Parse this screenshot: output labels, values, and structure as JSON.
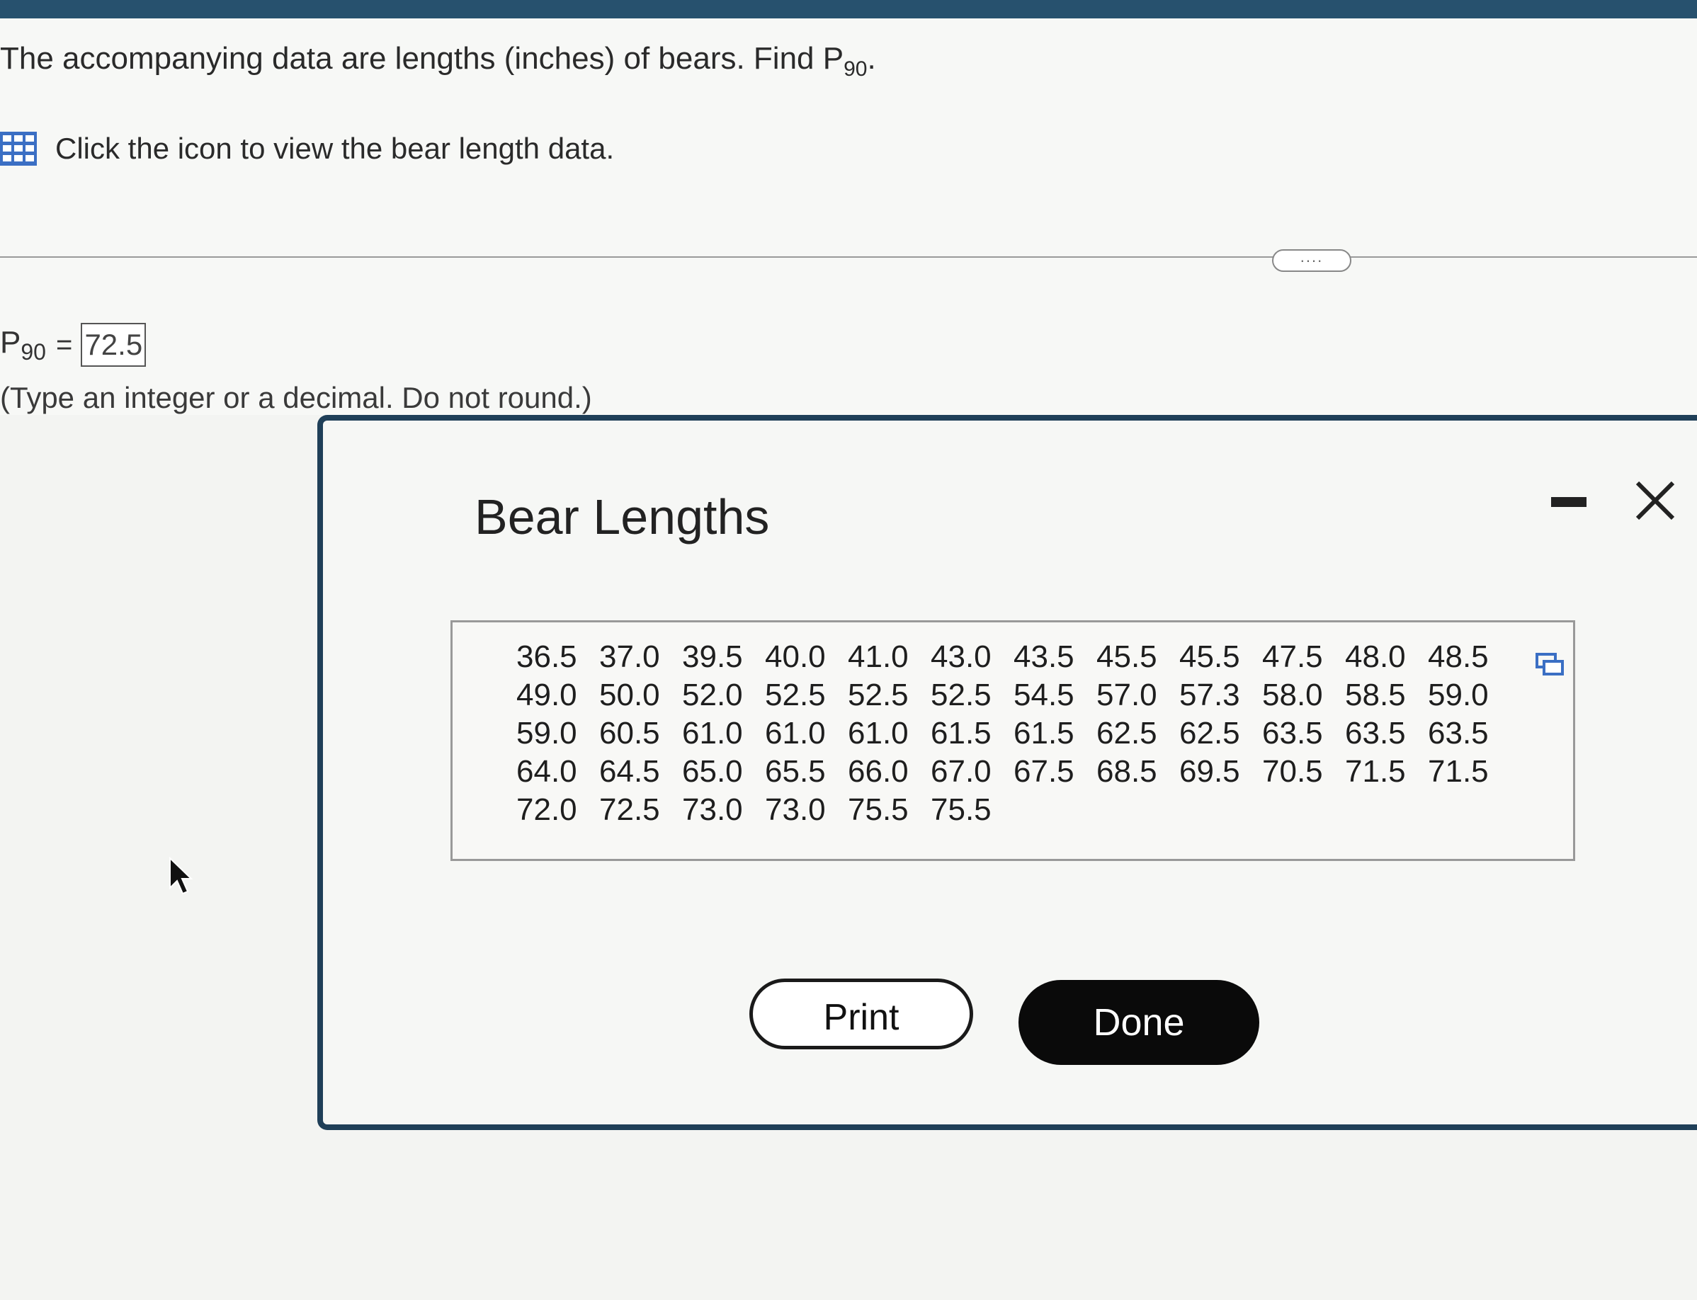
{
  "question": {
    "text_prefix": "The accompanying data are lengths (inches) of bears. Find P",
    "subscript": "90",
    "text_suffix": "."
  },
  "data_link": {
    "icon": "grid-icon",
    "text": "Click the icon to view the bear length data."
  },
  "more_button_label": "....",
  "answer": {
    "label": "P",
    "subscript": "90",
    "equals": "=",
    "value": "72.5",
    "hint": "(Type an integer or a decimal. Do not round.)"
  },
  "dialog": {
    "title": "Bear Lengths",
    "minimize_icon": "minimize-icon",
    "close_icon": "close-icon",
    "copy_icon": "copy-icon",
    "rows": [
      [
        "36.5",
        "37.0",
        "39.5",
        "40.0",
        "41.0",
        "43.0",
        "43.5",
        "45.5",
        "45.5",
        "47.5",
        "48.0",
        "48.5"
      ],
      [
        "49.0",
        "50.0",
        "52.0",
        "52.5",
        "52.5",
        "52.5",
        "54.5",
        "57.0",
        "57.3",
        "58.0",
        "58.5",
        "59.0"
      ],
      [
        "59.0",
        "60.5",
        "61.0",
        "61.0",
        "61.0",
        "61.5",
        "61.5",
        "62.5",
        "62.5",
        "63.5",
        "63.5",
        "63.5"
      ],
      [
        "64.0",
        "64.5",
        "65.0",
        "65.5",
        "66.0",
        "67.0",
        "67.5",
        "68.5",
        "69.5",
        "70.5",
        "71.5",
        "71.5"
      ],
      [
        "72.0",
        "72.5",
        "73.0",
        "73.0",
        "75.5",
        "75.5"
      ]
    ],
    "print_label": "Print",
    "done_label": "Done"
  },
  "colors": {
    "top_bar": "#27516e",
    "dialog_border": "#1f3f58",
    "grid_icon": "#3b6fc4",
    "done_button": "#0a0a0a"
  }
}
